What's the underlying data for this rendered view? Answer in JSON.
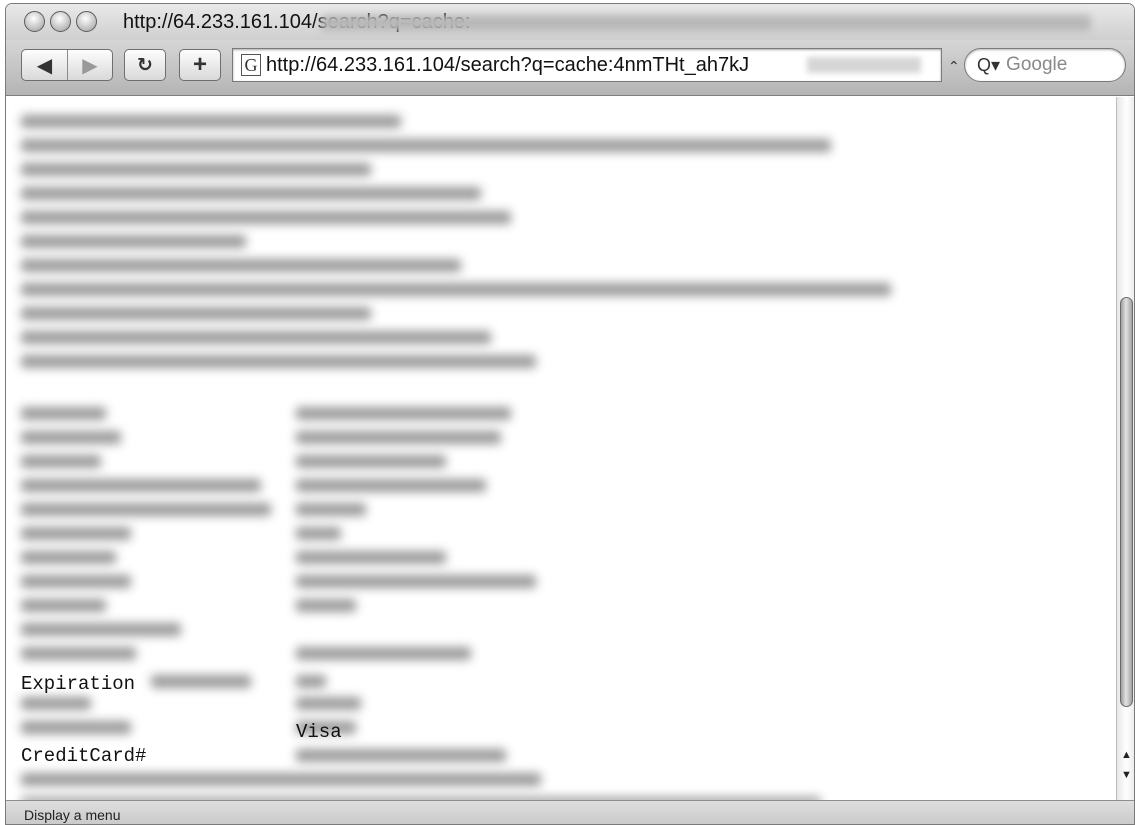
{
  "window": {
    "title": "http://64.233.161.104/search?q=cache:"
  },
  "toolbar": {
    "back_icon": "back-arrow-icon",
    "forward_icon": "forward-arrow-icon",
    "back_glyph": "◀",
    "forward_glyph": "▶",
    "reload_glyph": "↻",
    "add_glyph": "+",
    "url": "http://64.233.161.104/search?q=cache:4nmTHt_ah7kJ",
    "favicon_glyph": "G",
    "search_placeholder": "Google",
    "search_glyph": "Q▾",
    "chevron_glyph": "⌃"
  },
  "content": {
    "visible_lines": [
      {
        "text": "Expiration"
      },
      {
        "text": "Visa"
      },
      {
        "text": "CreditCard#"
      }
    ]
  },
  "statusbar": {
    "text": "Display a menu"
  }
}
